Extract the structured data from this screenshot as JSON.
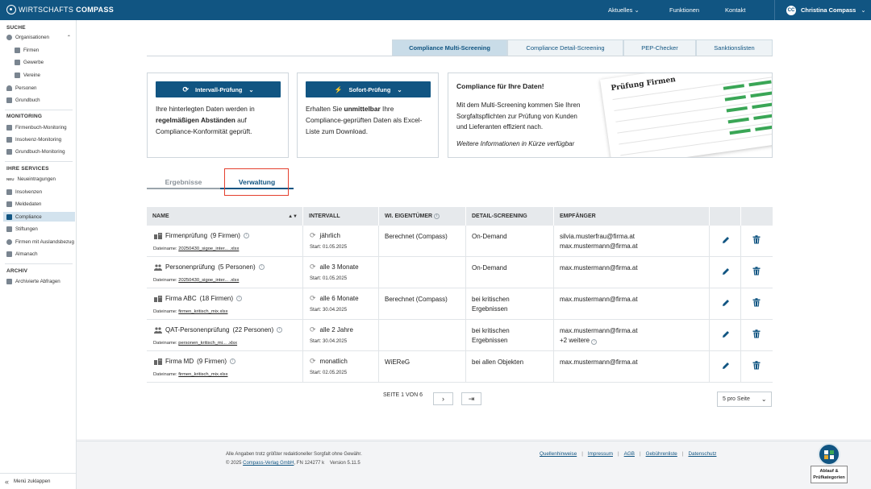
{
  "brand": {
    "name_light": "WIRTSCHAFTS",
    "name_bold": "COMPASS"
  },
  "topnav": {
    "aktuelles": "Aktuelles",
    "funktionen": "Funktionen",
    "kontakt": "Kontakt",
    "user": "Christina Compass",
    "user_initials": "CC"
  },
  "sidebar": {
    "suche_title": "SUCHE",
    "organisationen": "Organisationen",
    "firmen": "Firmen",
    "gewerbe": "Gewerbe",
    "vereine": "Vereine",
    "personen": "Personen",
    "grundbuch": "Grundbuch",
    "monitoring_title": "MONITORING",
    "firmenbuch_monitoring": "Firmenbuch-Monitoring",
    "insolvenz_monitoring": "Insolvenz-Monitoring",
    "grundbuch_monitoring": "Grundbuch-Monitoring",
    "services_title": "IHRE SERVICES",
    "neueintragungen": "Neueintragungen",
    "neu_badge": "NEU",
    "insolvenzen": "Insolvenzen",
    "meldedaten": "Meldedaten",
    "compliance": "Compliance",
    "stiftungen": "Stiftungen",
    "auslandsbezug": "Firmen mit Auslandsbezug",
    "almanach": "Almanach",
    "archiv_title": "ARCHIV",
    "archivierte": "Archivierte Abfragen",
    "collapse": "Menü zuklappen"
  },
  "tabs": [
    "Compliance Multi-Screening",
    "Compliance Detail-Screening",
    "PEP-Checker",
    "Sanktionslisten"
  ],
  "cards": {
    "c1": {
      "button": "Intervall-Prüfung",
      "t1": "Ihre hinterlegten Daten werden in",
      "t2b": "regelmäßigen Abständen",
      "t2": " auf",
      "t3": "Compliance-Konformität geprüft."
    },
    "c2": {
      "button": "Sofort-Prüfung",
      "t1": "Erhalten Sie ",
      "t1b": "unmittelbar",
      "t1c": " Ihre",
      "t2": "Compliance-geprüften Daten als Excel-",
      "t3": "Liste zum Download."
    },
    "promo": {
      "title": "Compliance für Ihre Daten!",
      "t1": "Mit dem Multi-Screening kommen Sie Ihren",
      "t2": "Sorgfaltspflichten zur Prüfung von Kunden",
      "t3": "und Lieferanten effizient nach.",
      "note": "Weitere Informationen in Kürze verfügbar",
      "paper_title": "Prüfung Firmen"
    }
  },
  "subtabs": {
    "ergebnisse": "Ergebnisse",
    "verwaltung": "Verwaltung"
  },
  "table": {
    "headers": {
      "name": "NAME",
      "intervall": "INTERVALL",
      "eigentuemer": "WI. EIGENTÜMER",
      "detail": "DETAIL-SCREENING",
      "empfaenger": "EMPFÄNGER"
    },
    "file_label": "Dateiname: ",
    "start_label": "Start: ",
    "rows": [
      {
        "name": "Firmenprüfung",
        "count": "(9 Firmen)",
        "file": "20250430_sigoe_inter... .xlsx",
        "interval": "jährlich",
        "start": "01.05.2025",
        "owner": "Berechnet (Compass)",
        "detail1": "On-Demand",
        "detail2": "",
        "r1": "silvia.musterfrau@firma.at",
        "r2": "max.mustermann@firma.at"
      },
      {
        "name": "Personenprüfung",
        "count": "(5 Personen)",
        "file": "20250430_sigoe_inter... .xlsx",
        "interval": "alle 3 Monate",
        "start": "01.05.2025",
        "owner": "",
        "detail1": "On-Demand",
        "detail2": "",
        "r1": "max.mustermann@firma.at",
        "r2": ""
      },
      {
        "name": "Firma ABC",
        "count": "(18 Firmen)",
        "file": "firmen_kritisch_mix.xlsx",
        "interval": "alle 6 Monate",
        "start": "30.04.2025",
        "owner": "Berechnet (Compass)",
        "detail1": "bei kritischen",
        "detail2": "Ergebnissen",
        "r1": "max.mustermann@firma.at",
        "r2": ""
      },
      {
        "name": "QAT-Personenprüfung",
        "count": "(22 Personen)",
        "file": "personen_kritisch_mi... .xlsx",
        "interval": "alle 2 Jahre",
        "start": "30.04.2025",
        "owner": "",
        "detail1": "bei kritischen",
        "detail2": "Ergebnissen",
        "r1": "max.mustermann@firma.at",
        "r2": "+2 weitere"
      },
      {
        "name": "Firma MD",
        "count": "(9 Firmen)",
        "file": "firmen_kritisch_mix.xlsx",
        "interval": "monatlich",
        "start": "02.05.2025",
        "owner": "WiEReG",
        "detail1": "bei allen Objekten",
        "detail2": "",
        "r1": "max.mustermann@firma.at",
        "r2": ""
      }
    ]
  },
  "pagination": {
    "label": "SEITE 1 VON 6",
    "per_page": "5 pro Seite"
  },
  "footer": {
    "line1": "Alle Angaben trotz größter redaktioneller Sorgfalt ohne Gewähr.",
    "copy_pre": "© 2025 ",
    "copy_link": "Compass-Verlag GmbH",
    "copy_post": ", FN 124277 k    Version 5.11.5",
    "links": [
      "Quellenhinweise",
      "Impressum",
      "AGB",
      "Gebührenliste",
      "Datenschutz"
    ],
    "help_l1": "Ablauf &",
    "help_l2": "Prüfkategorien"
  },
  "colors": {
    "primary": "#115582",
    "active_bg": "#d3e3ee",
    "delete": "#115582",
    "highlight": "#e4402e",
    "green": "#3aa656"
  }
}
